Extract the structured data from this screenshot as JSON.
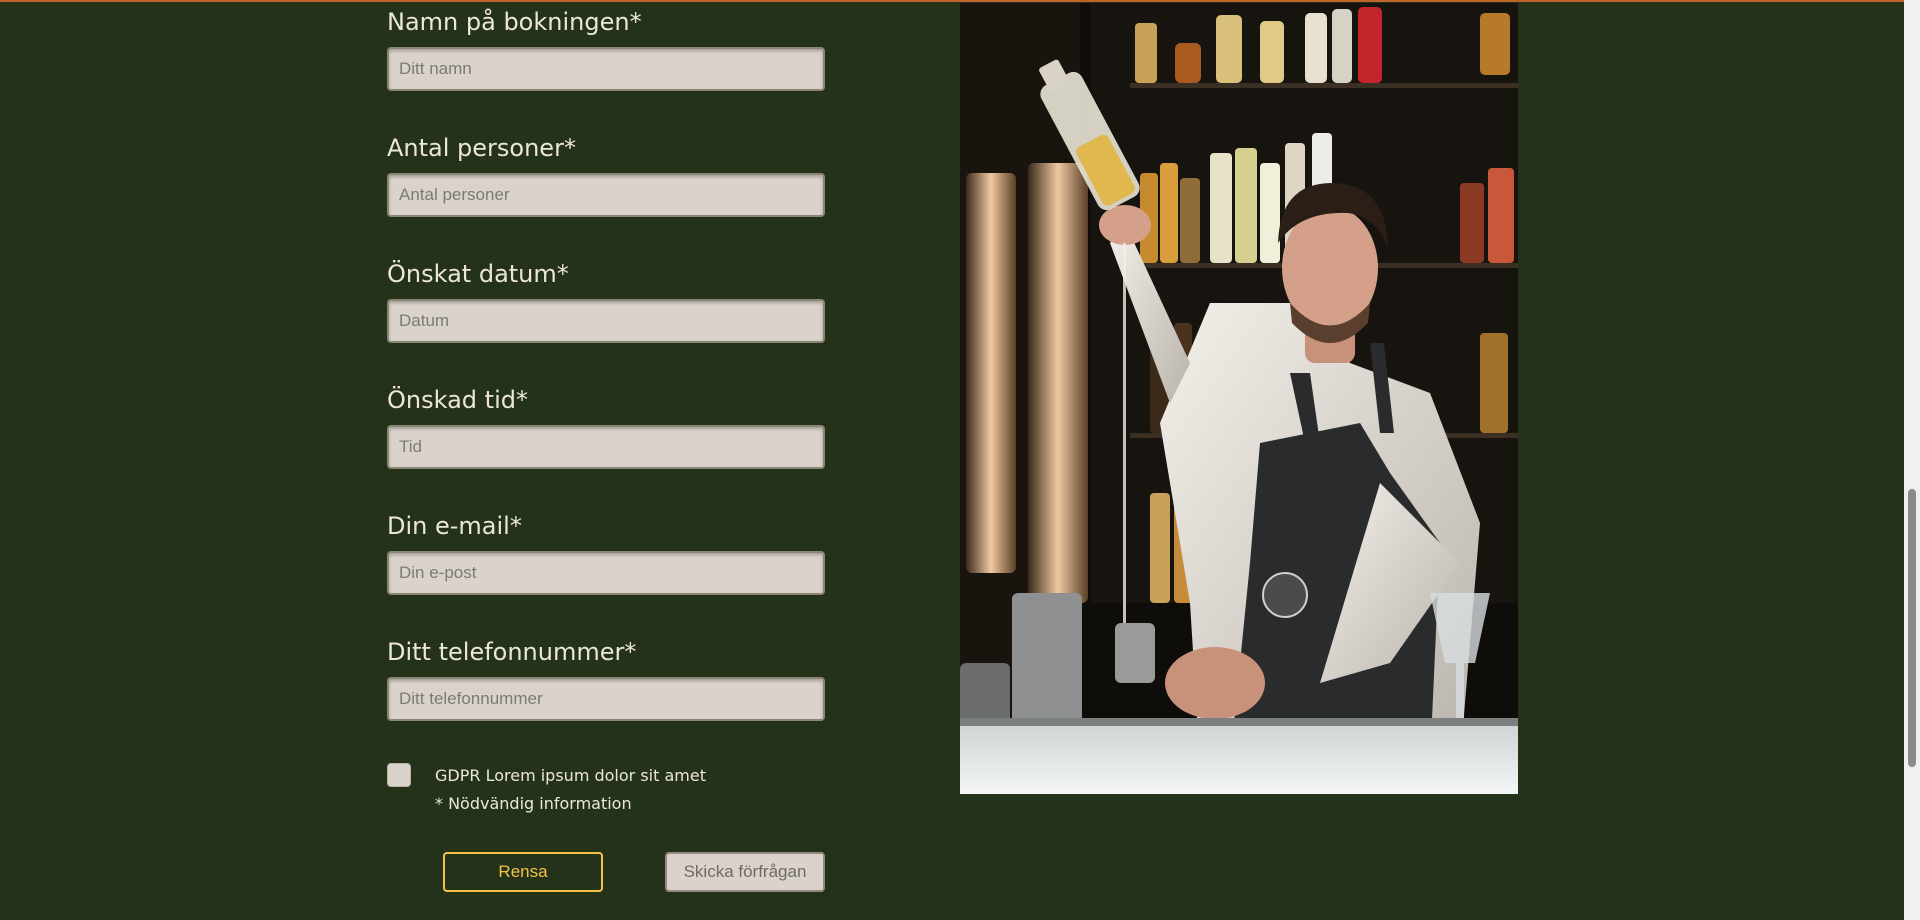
{
  "form": {
    "fields": [
      {
        "label": "Namn på bokningen*",
        "placeholder": "Ditt namn"
      },
      {
        "label": "Antal personer*",
        "placeholder": "Antal personer"
      },
      {
        "label": "Önskat datum*",
        "placeholder": "Datum"
      },
      {
        "label": "Önskad tid*",
        "placeholder": "Tid"
      },
      {
        "label": "Din e-mail*",
        "placeholder": "Din e-post"
      },
      {
        "label": "Ditt telefonnummer*",
        "placeholder": "Ditt telefonnummer"
      }
    ],
    "gdpr_label": "GDPR Lorem ipsum dolor sit amet",
    "required_note": "* Nödvändig information",
    "reset_label": "Rensa",
    "submit_label": "Skicka förfrågan"
  },
  "colors": {
    "background": "#25321a",
    "accent": "#f1c246",
    "input_bg": "#d9d3cb",
    "text": "#ece6d6",
    "top_line": "#c0652a"
  }
}
